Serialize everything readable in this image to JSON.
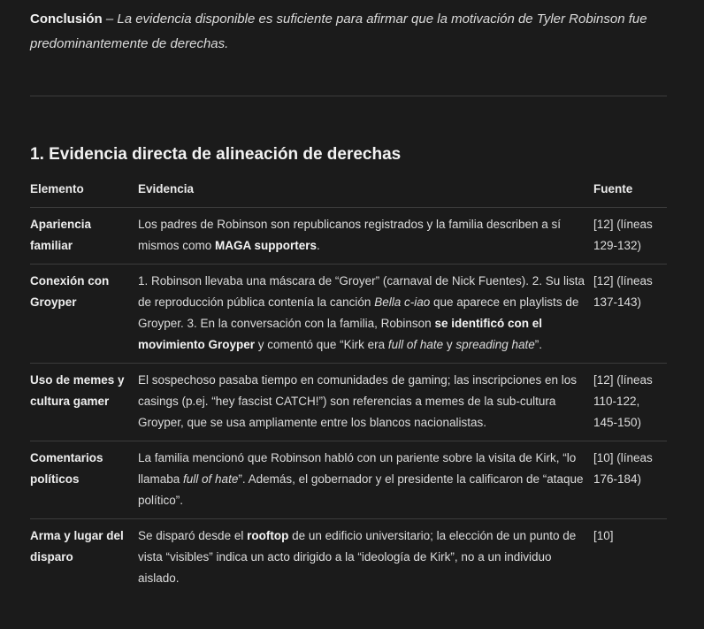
{
  "conclusion": {
    "label": "Conclusión",
    "dash": " – ",
    "text": "La evidencia disponible es suficiente para afirmar que la motivación de Tyler Robinson fue predominantemente de derechas."
  },
  "section": {
    "title": "1. Evidencia directa de alineación de derechas"
  },
  "table": {
    "headers": [
      "Elemento",
      "Evidencia",
      "Fuente"
    ],
    "rows": [
      {
        "element": "Apariencia familiar",
        "evidence": {
          "p1": "Los padres de Robinson son republicanos registrados y la familia describen a sí mismos como ",
          "b1": "MAGA supporters",
          "p2": "."
        },
        "source": "[12] (líneas 129-132)"
      },
      {
        "element": "Conexión con Groyper",
        "evidence": {
          "p1": "1. Robinson llevaba una máscara de “Groyer” (carnaval de Nick Fuentes). 2. Su lista de reproducción pública contenía la canción ",
          "i1": "Bella c-iao",
          "p2": " que aparece en playlists de Groyper. 3. En la conversación con la familia, Robinson ",
          "b1": "se identificó con el movimiento Groyper",
          "p3": " y comentó que “Kirk era ",
          "i2": "full of hate",
          "p4": " y ",
          "i3": "spreading hate",
          "p5": "”."
        },
        "source": "[12] (líneas 137-143)"
      },
      {
        "element": "Uso de memes y cultura gamer",
        "evidence": {
          "p1": "El sospechoso pasaba tiempo en comunidades de gaming; las inscripciones en los casings (p.ej. “hey fascist CATCH!”) son referencias a memes de la sub-cultura Groyper, que se usa ampliamente entre los blancos nacionalistas."
        },
        "source": "[12] (líneas 110-122, 145-150)"
      },
      {
        "element": "Comentarios políticos",
        "evidence": {
          "p1": "La familia mencionó que Robinson habló con un pariente sobre la visita de Kirk, “lo llamaba ",
          "i1": "full of hate",
          "p2": "”. Además, el gobernador y el presidente la calificaron de “ataque político”."
        },
        "source": "[10] (líneas 176-184)"
      },
      {
        "element": "Arma y lugar del disparo",
        "evidence": {
          "p1": "Se disparó desde el ",
          "b1": "rooftop",
          "p2": " de un edificio universitario; la elección de un punto de vista “visibles” indica un acto dirigido a la “ideología de Kirk”, no a un individuo aislado."
        },
        "source": "[10]"
      }
    ]
  }
}
